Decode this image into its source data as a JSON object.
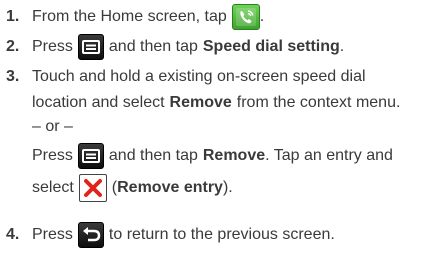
{
  "steps": [
    {
      "number": "1.",
      "before": "From the Home screen, tap",
      "after": ".",
      "icon": "phone-icon"
    },
    {
      "number": "2.",
      "before": "Press",
      "middle": "and then tap",
      "bold": "Speed dial setting",
      "after": ".",
      "icon": "menu-icon"
    },
    {
      "number": "3.",
      "line1": "Touch and hold a existing on-screen speed dial",
      "line2_before": "location and select",
      "line2_bold": "Remove",
      "line2_after": "from the context menu.",
      "or": "– or –",
      "line4_before": "Press",
      "line4_middle": "and then tap",
      "line4_bold": "Remove",
      "line4_after": ". Tap an entry and",
      "line5_before": "select",
      "line5_paren_open": "(",
      "line5_bold": "Remove entry",
      "line5_paren_close": ").",
      "menu_icon": "menu-icon",
      "remove_icon": "remove-x-icon"
    },
    {
      "number": "4.",
      "before": "Press",
      "after": "to return to the previous screen.",
      "icon": "back-icon"
    }
  ],
  "colors": {
    "text": "#3a3a3a",
    "phone_icon_bg": "#4cb83a",
    "remove_x": "#e0241b"
  }
}
